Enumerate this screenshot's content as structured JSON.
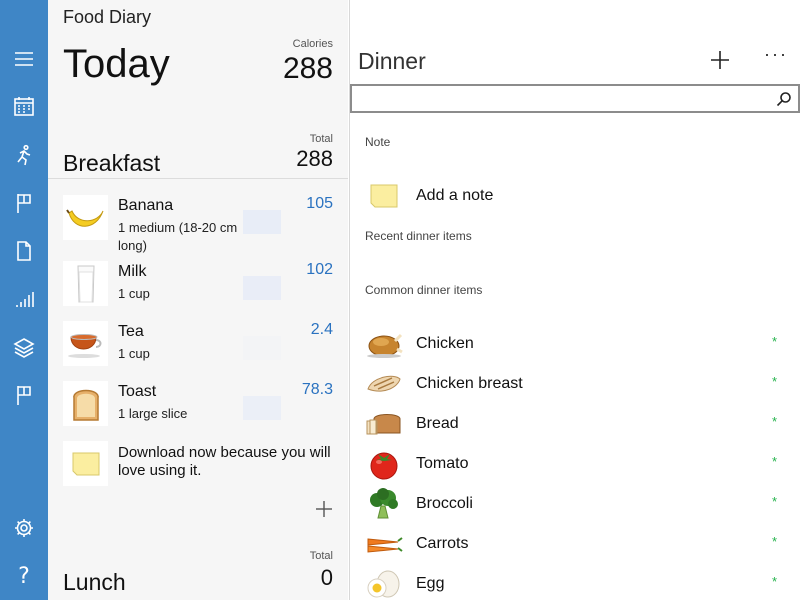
{
  "diary": {
    "app_title": "Food Diary",
    "day_title": "Today",
    "calories_label": "Calories",
    "calories_value": "288",
    "breakfast": {
      "name": "Breakfast",
      "total_label": "Total",
      "total_value": "288",
      "items": [
        {
          "name": "Banana",
          "serving": "1 medium (18-20 cm long)",
          "calories": "105",
          "bar_fill": 1.0
        },
        {
          "name": "Milk",
          "serving": "1 cup",
          "calories": "102",
          "bar_fill": 0.97
        },
        {
          "name": "Tea",
          "serving": "1 cup",
          "calories": "2.4",
          "bar_fill": 0.02
        },
        {
          "name": "Toast",
          "serving": "1 large slice",
          "calories": "78.3",
          "bar_fill": 0.75
        }
      ],
      "note_text": "Download now because you will love using it."
    },
    "lunch": {
      "name": "Lunch",
      "total_label": "Total",
      "total_value": "0"
    }
  },
  "detail": {
    "title": "Dinner",
    "search": {
      "value": "",
      "placeholder": ""
    },
    "note_section_label": "Note",
    "add_note_label": "Add a note",
    "recent_section_label": "Recent dinner items",
    "common_section_label": "Common dinner items",
    "common_items": [
      {
        "label": "Chicken",
        "star": "*"
      },
      {
        "label": "Chicken breast",
        "star": "*"
      },
      {
        "label": "Bread",
        "star": "*"
      },
      {
        "label": "Tomato",
        "star": "*"
      },
      {
        "label": "Broccoli",
        "star": "*"
      },
      {
        "label": "Carrots",
        "star": "*"
      },
      {
        "label": "Egg",
        "star": "*"
      }
    ]
  },
  "rail_icons": [
    "menu-icon",
    "calendar-icon",
    "running-icon",
    "flag-icon",
    "document-icon",
    "signal-bars-icon",
    "layers-icon",
    "flag-icon",
    "gear-icon",
    "help-icon"
  ],
  "colors": {
    "rail": "#3f86c6",
    "calorie_blue": "#2a72c0",
    "star_green": "#24b24b",
    "bar_fill": "#e8edf7"
  }
}
